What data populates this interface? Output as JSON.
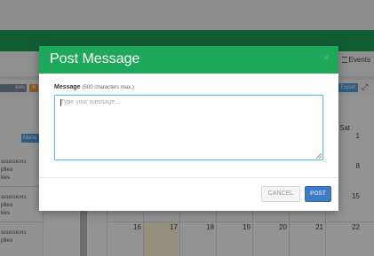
{
  "background": {
    "events_label": "Events",
    "left_button_label": "ews",
    "export_label": "Export",
    "manage_label": "Mana",
    "sidebar_blocks": [
      {
        "line1": "scussions",
        "line2": "plies",
        "line3": "kes"
      },
      {
        "line1": "scussions",
        "line2": "plies",
        "line3": "kes"
      },
      {
        "line1": "scussions",
        "line2": "plies"
      }
    ],
    "calendar": {
      "sat_header": "Sat",
      "right_column_days": [
        "1",
        "8",
        "15"
      ],
      "bottom_row_days": [
        "16",
        "17",
        "18",
        "19",
        "20",
        "21",
        "22"
      ]
    }
  },
  "modal": {
    "title": "Post Message",
    "close_icon": "close-icon",
    "field_label": "Message",
    "field_hint": "(500 characters max.)",
    "message_placeholder": "Type your message...",
    "message_value": "",
    "cancel_label": "CANCEL",
    "post_label": "POST"
  },
  "colors": {
    "header_green": "#1ea85b",
    "post_blue": "#3d7dc6",
    "focus_border": "#74b6e0"
  }
}
